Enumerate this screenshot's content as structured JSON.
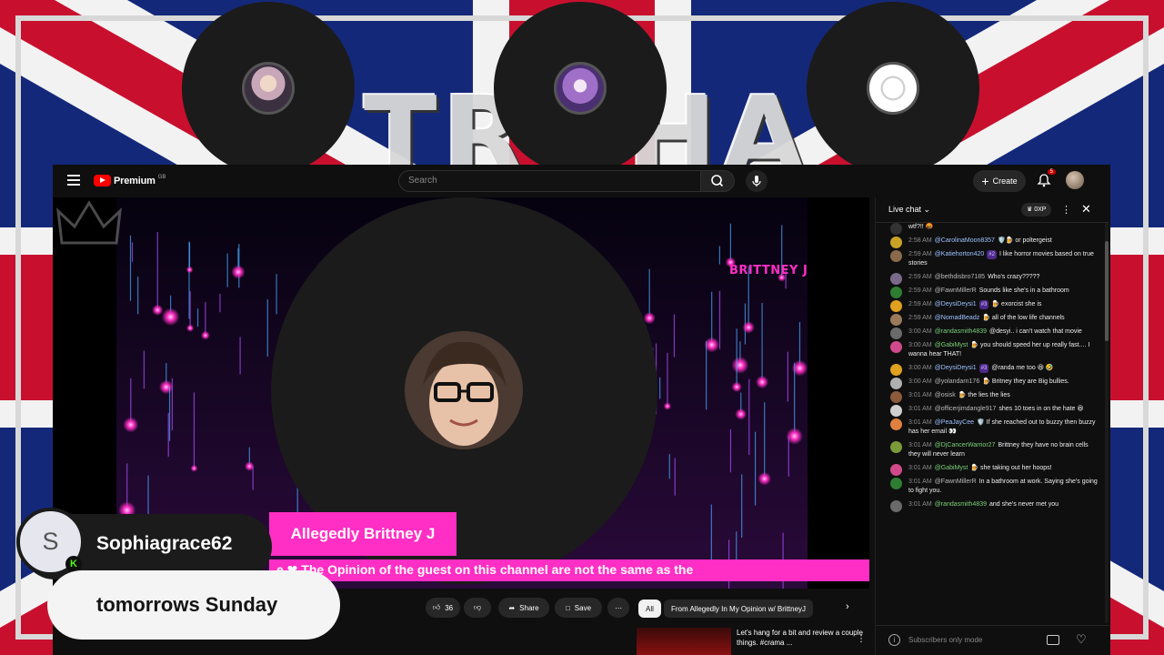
{
  "banner": {
    "text": "TROHA"
  },
  "top_avatars": [
    {
      "name": "guest-avatar-1",
      "color": "#c8a8b8"
    },
    {
      "name": "guest-avatar-2",
      "color": "#a070c8"
    },
    {
      "name": "guest-avatar-3",
      "color": "#f2f2f2"
    }
  ],
  "youtube": {
    "logo": "Premium",
    "logo_region": "GB",
    "search_placeholder": "Search",
    "create_label": "Create",
    "notification_count": "5"
  },
  "video": {
    "brand": "BRITTNEY J",
    "lower_third": "Allegedly Brittney J",
    "ticker": "e ❤ The Opinion of the guest on this channel are not the same as the"
  },
  "actions": {
    "likes": "36",
    "share": "Share",
    "save": "Save"
  },
  "chips": {
    "all": "All",
    "from": "From Allegedly In My Opinion w/ BrittneyJ"
  },
  "recommendation": {
    "title": "Let's hang for a bit and review a couple things. #crama ..."
  },
  "chat": {
    "title": "Live chat",
    "xp": "0XP",
    "input_placeholder": "Subscribers only mode",
    "messages": [
      {
        "time": "",
        "author": "",
        "text": "wtf?!! 🤬",
        "color": "#333"
      },
      {
        "time": "2:58 AM",
        "author": "@CarolinaMoon8357",
        "badge": "",
        "text": "🛡️🍺 or poltergeist",
        "color": "#c9a227"
      },
      {
        "time": "2:59 AM",
        "author": "@Katiehorton420",
        "badge": "#2",
        "text": "I like horror movies based on true stories",
        "color": "#8a6a4a"
      },
      {
        "time": "2:59 AM",
        "author": "@bethdisbro7185",
        "badge": "",
        "text": "Who's crazy?????",
        "color": "#7a6a8a",
        "authorStyle": "w"
      },
      {
        "time": "2:59 AM",
        "author": "@FawnMillerR",
        "badge": "",
        "text": "Sounds like she's in a bathroom",
        "color": "#2e7d32",
        "authorStyle": "w"
      },
      {
        "time": "2:59 AM",
        "author": "@DeysiDeysi1",
        "badge": "#3",
        "text": "🍺 exorcist she is",
        "color": "#e0a020"
      },
      {
        "time": "2:59 AM",
        "author": "@NomadBeadz",
        "badge": "",
        "text": "🍺 all of the low life channels",
        "color": "#9a7a5a"
      },
      {
        "time": "3:00 AM",
        "author": "@randasmith4839",
        "badge": "",
        "text": "@desyi.. i can't watch that movie",
        "color": "#6a6a6a",
        "authorStyle": "g"
      },
      {
        "time": "3:00 AM",
        "author": "@GabiMyst",
        "badge": "",
        "text": "🍺 you should speed her up really fast.... I wanna hear THAT!",
        "color": "#d04a8a",
        "authorStyle": "g"
      },
      {
        "time": "3:00 AM",
        "author": "@DeysiDeysi1",
        "badge": "#3",
        "text": "@randa me too 😆 🤣",
        "color": "#e0a020"
      },
      {
        "time": "3:00 AM",
        "author": "@yolandarn176",
        "badge": "",
        "text": "🍺 Britney they are Big bullies.",
        "color": "#b0b0b0",
        "authorStyle": "w"
      },
      {
        "time": "3:01 AM",
        "author": "@osisk",
        "badge": "",
        "text": "🍺 the lies the lies",
        "color": "#8a5a3a",
        "authorStyle": "w"
      },
      {
        "time": "3:01 AM",
        "author": "@officerjimdangle917",
        "badge": "",
        "text": "shes 10 toes in on the hate 😆",
        "color": "#d0d0d0",
        "authorStyle": "w"
      },
      {
        "time": "3:01 AM",
        "author": "@PeaJayCee",
        "badge": "",
        "text": "🛡️ If she reached out to buzzy then buzzy has her email 👀",
        "color": "#e08040"
      },
      {
        "time": "3:01 AM",
        "author": "@DjCancerWarrior27",
        "badge": "",
        "text": "Brittney they have no brain cells they will never learn",
        "color": "#7a9a3a",
        "authorStyle": "g"
      },
      {
        "time": "3:01 AM",
        "author": "@GabiMyst",
        "badge": "",
        "text": "🍺 she taking out her hoops!",
        "color": "#d04a8a",
        "authorStyle": "g"
      },
      {
        "time": "3:01 AM",
        "author": "@FawnMillerR",
        "badge": "",
        "text": "In a bathroom at work. Saying she's going to fight you.",
        "color": "#2e7d32",
        "authorStyle": "w"
      },
      {
        "time": "3:01 AM",
        "author": "@randasmith4839",
        "badge": "",
        "text": "and she's never met you",
        "color": "#6a6a6a",
        "authorStyle": "g"
      }
    ]
  },
  "overlay": {
    "avatar_letter": "S",
    "platform_badge": "K",
    "username": "Sophiagrace62",
    "message": "tomorrows Sunday"
  }
}
